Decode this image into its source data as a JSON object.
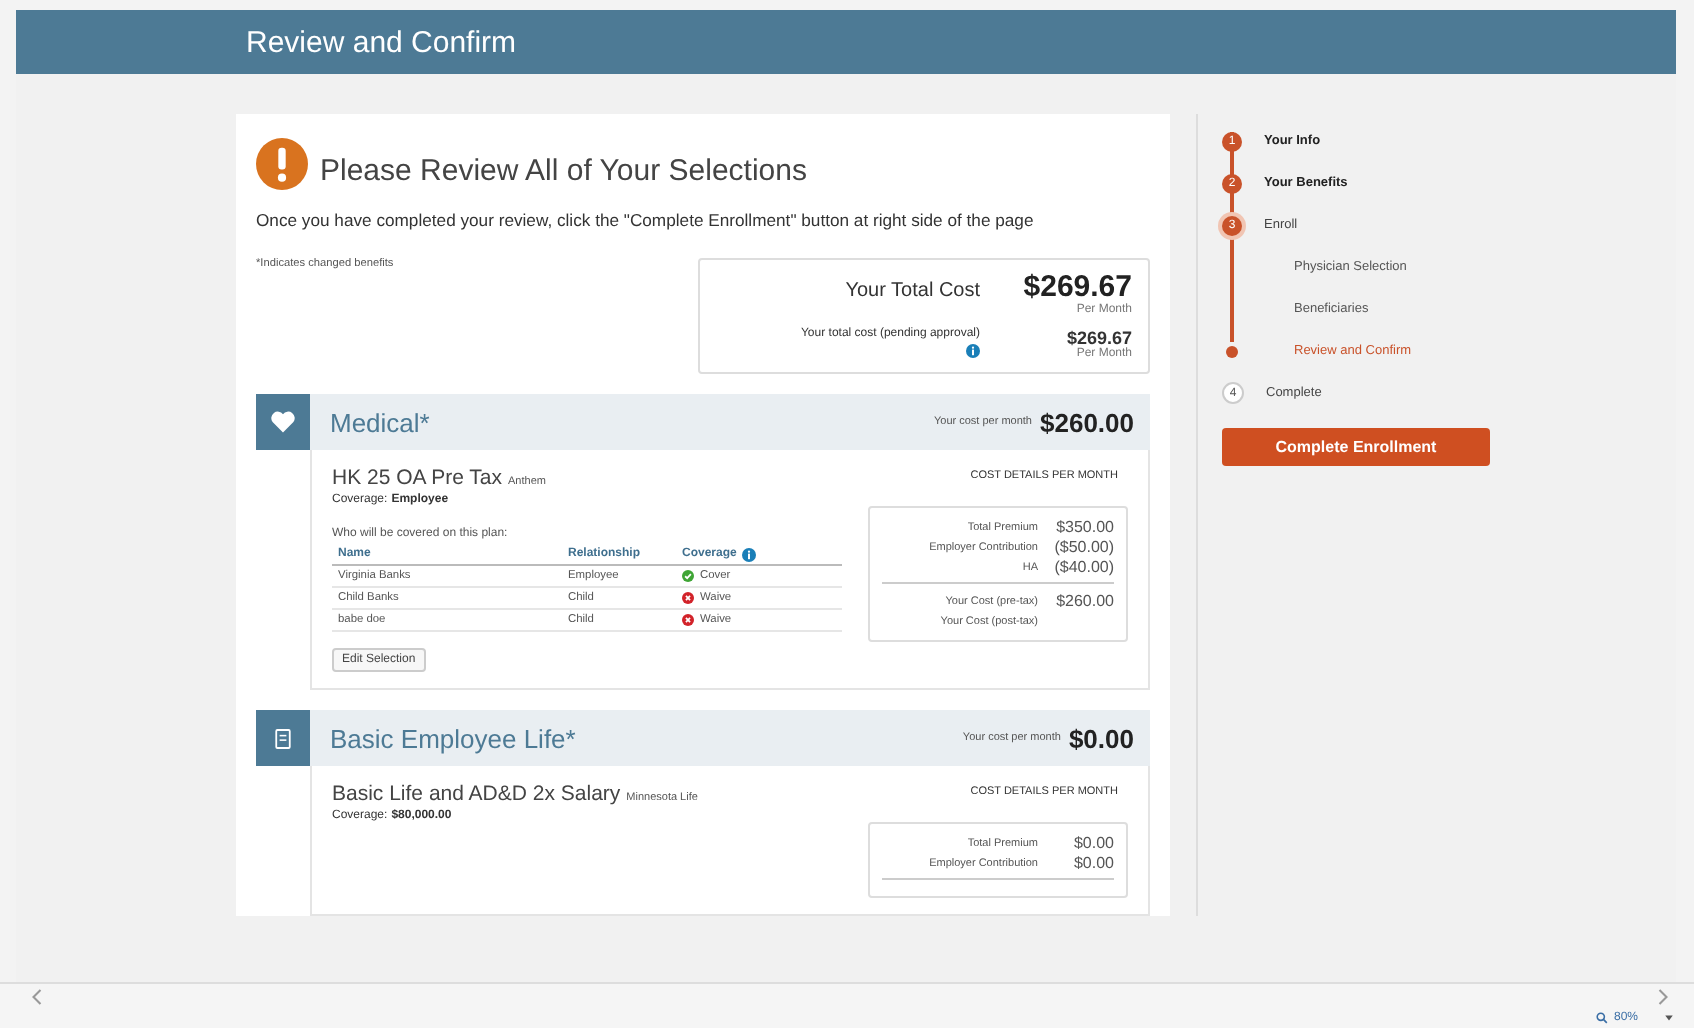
{
  "header": {
    "title": "Review and Confirm"
  },
  "summary": {
    "title": "Please Review All of Your Selections",
    "instruction": "Once you have completed your review, click the \"Complete Enrollment\" button at right side of the page",
    "note": "*Indicates changed benefits",
    "total": {
      "label": "Your Total Cost",
      "amount": "$269.67",
      "per": "Per Month"
    },
    "pending": {
      "label": "Your total cost (pending approval)",
      "amount": "$269.67",
      "per": "Per Month"
    }
  },
  "benefits": [
    {
      "kind": "medical",
      "title": "Medical*",
      "cost_label": "Your cost per month",
      "cost": "$260.00",
      "plan": "HK 25 OA Pre Tax",
      "carrier": "Anthem",
      "coverage_label": "Coverage:",
      "coverage_value": "Employee",
      "covered_label": "Who will be covered on this plan:",
      "columns": [
        "Name",
        "Relationship",
        "Coverage"
      ],
      "members": [
        {
          "name": "Virginia Banks",
          "relationship": "Employee",
          "coverage": "Cover",
          "covered": true
        },
        {
          "name": "Child Banks",
          "relationship": "Child",
          "coverage": "Waive",
          "covered": false
        },
        {
          "name": "babe doe",
          "relationship": "Child",
          "coverage": "Waive",
          "covered": false
        }
      ],
      "edit_button": "Edit Selection",
      "cost_header": "COST DETAILS PER MONTH",
      "cost_rows": [
        {
          "label": "Total Premium",
          "value": "$350.00"
        },
        {
          "label": "Employer Contribution",
          "value": "($50.00)"
        },
        {
          "label": "HA",
          "value": "($40.00)"
        }
      ],
      "cost_totals": [
        {
          "label": "Your Cost (pre-tax)",
          "value": "$260.00"
        },
        {
          "label": "Your Cost (post-tax)"
        }
      ]
    },
    {
      "kind": "life",
      "title": "Basic Employee Life*",
      "cost_label": "Your cost per month",
      "cost": "$0.00",
      "plan": "Basic Life and AD&D 2x Salary",
      "carrier": "Minnesota Life",
      "coverage_label": "Coverage:",
      "coverage_value": "$80,000.00",
      "cost_header": "COST DETAILS PER MONTH",
      "cost_rows": [
        {
          "label": "Total Premium",
          "value": "$0.00"
        },
        {
          "label": "Employer Contribution",
          "value": "$0.00"
        }
      ]
    }
  ],
  "steps": [
    {
      "number": "1",
      "label": "Your Info",
      "completed": true,
      "selected": false
    },
    {
      "number": "2",
      "label": "Your Benefits",
      "completed": true,
      "selected": false
    },
    {
      "number": "3",
      "label": "Enroll",
      "completed": false,
      "selected": true,
      "children": [
        {
          "label": "Physician Selection",
          "selected": false
        },
        {
          "label": "Beneficiaries",
          "selected": false
        },
        {
          "label": "Review and Confirm",
          "selected": true
        }
      ]
    },
    {
      "number": "4",
      "label": "Complete",
      "completed": false,
      "selected": false
    }
  ],
  "complete_button": "Complete Enrollment",
  "browser": {
    "zoom": "80%"
  }
}
